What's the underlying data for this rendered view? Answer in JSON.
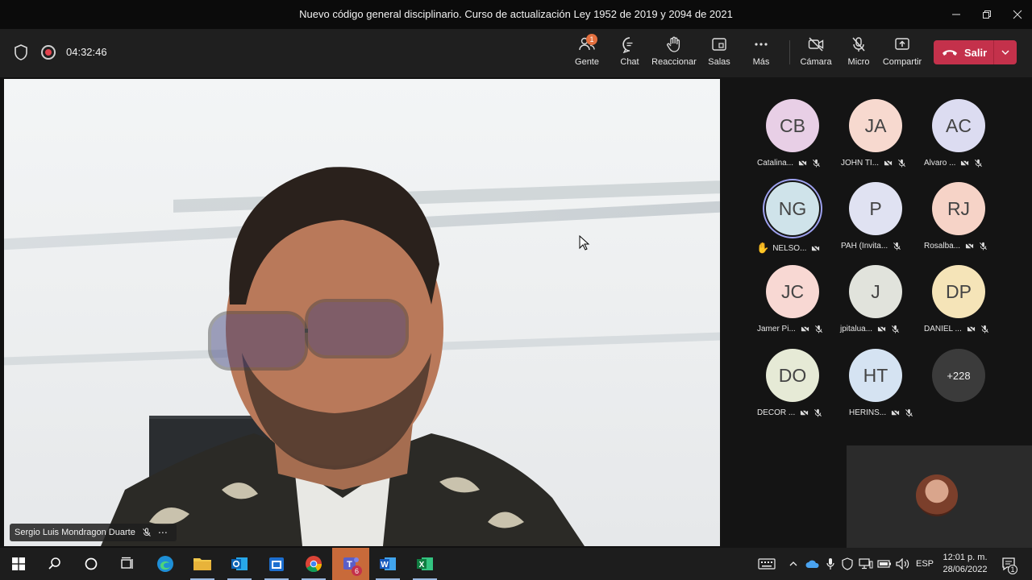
{
  "window": {
    "title": "Nuevo código general disciplinario. Curso de actualización Ley 1952 de 2019 y 2094 de 2021"
  },
  "meeting": {
    "timer": "04:32:46",
    "people_badge": "1",
    "toolbar": {
      "people": "Gente",
      "chat": "Chat",
      "react": "Reaccionar",
      "rooms": "Salas",
      "more": "Más",
      "camera": "Cámara",
      "mic": "Micro",
      "share": "Compartir",
      "leave": "Salir"
    },
    "speaker": {
      "name": "Sergio Luis Mondragon Duarte"
    },
    "participants": [
      {
        "initials": "CB",
        "name": "Catalina...",
        "color": "#e8cfe6"
      },
      {
        "initials": "JA",
        "name": "JOHN TI...",
        "color": "#f7d9cf"
      },
      {
        "initials": "AC",
        "name": "Alvaro ...",
        "color": "#dcdcf1"
      },
      {
        "initials": "NG",
        "name": "NELSO...",
        "color": "#cfe3ea",
        "hand_raised": true
      },
      {
        "initials": "P",
        "name": "PAH (Invita...",
        "color": "#e0e2f2"
      },
      {
        "initials": "RJ",
        "name": "Rosalba...",
        "color": "#f6d3c7"
      },
      {
        "initials": "JC",
        "name": "Jamer Pi...",
        "color": "#f8d8d3"
      },
      {
        "initials": "J",
        "name": "jpitalua...",
        "color": "#e1e3dc"
      },
      {
        "initials": "DP",
        "name": "DANIEL ...",
        "color": "#f5e4b8"
      },
      {
        "initials": "DO",
        "name": "DECOR ...",
        "color": "#e6ead6"
      },
      {
        "initials": "HT",
        "name": "HERINS...",
        "color": "#d5e3f2"
      }
    ],
    "overflow_count": "+228"
  },
  "taskbar": {
    "teams_badge": "6",
    "language": "ESP",
    "time": "12:01 p. m.",
    "date": "28/06/2022",
    "notification_count": "1"
  }
}
